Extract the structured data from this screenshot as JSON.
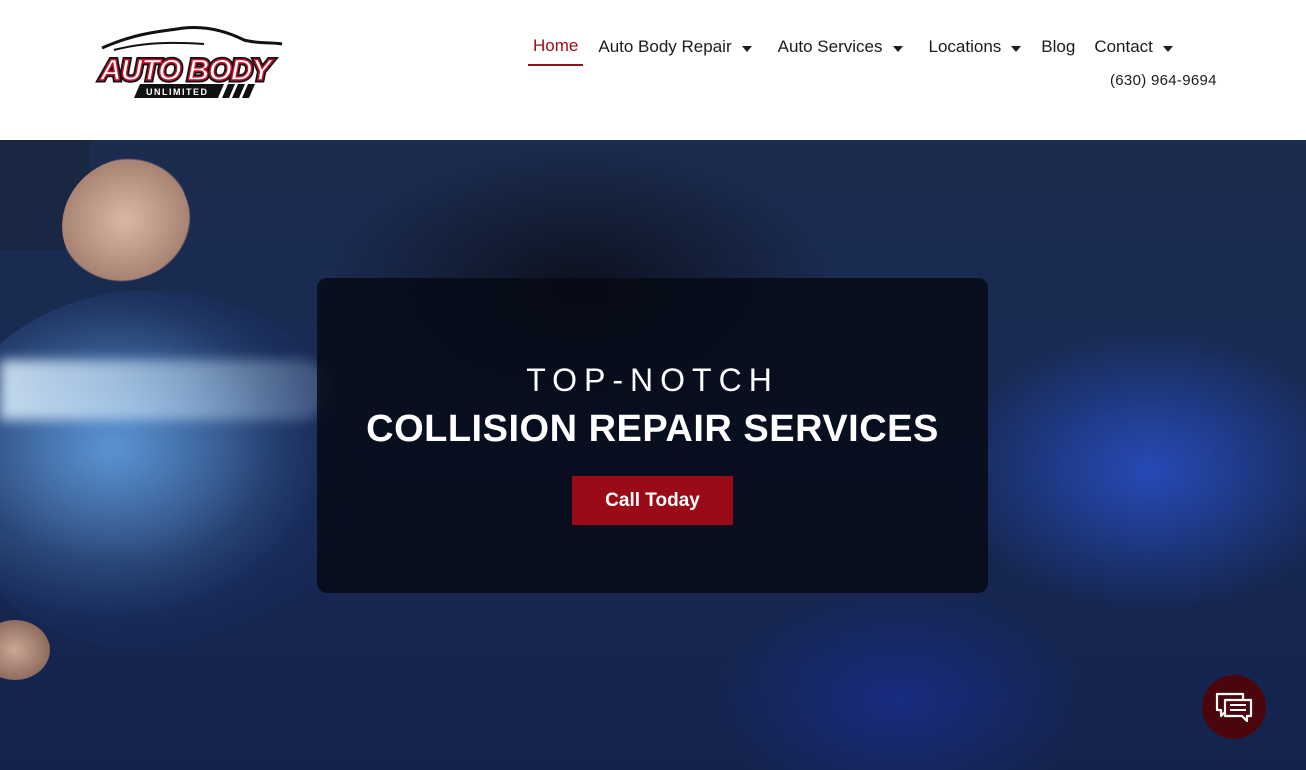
{
  "header": {
    "logo": {
      "text_main": "AUTO BODY",
      "text_sub": "UNLIMITED"
    },
    "nav": [
      {
        "label": "Home",
        "active": true,
        "dropdown": false
      },
      {
        "label": "Auto Body Repair",
        "active": false,
        "dropdown": true
      },
      {
        "label": "Auto Services",
        "active": false,
        "dropdown": true
      },
      {
        "label": "Locations",
        "active": false,
        "dropdown": true
      },
      {
        "label": "Blog",
        "active": false,
        "dropdown": false
      },
      {
        "label": "Contact",
        "active": false,
        "dropdown": true
      }
    ],
    "phone": "(630) 964-9694"
  },
  "hero": {
    "kicker": "TOP-NOTCH",
    "title": "COLLISION REPAIR SERVICES",
    "cta_label": "Call Today"
  },
  "colors": {
    "accent": "#9b0a17",
    "chat_bubble": "#4a060c",
    "text": "#1b1b1b"
  },
  "icons": {
    "chat": "chat-bubbles-icon",
    "caret": "caret-down-icon"
  }
}
